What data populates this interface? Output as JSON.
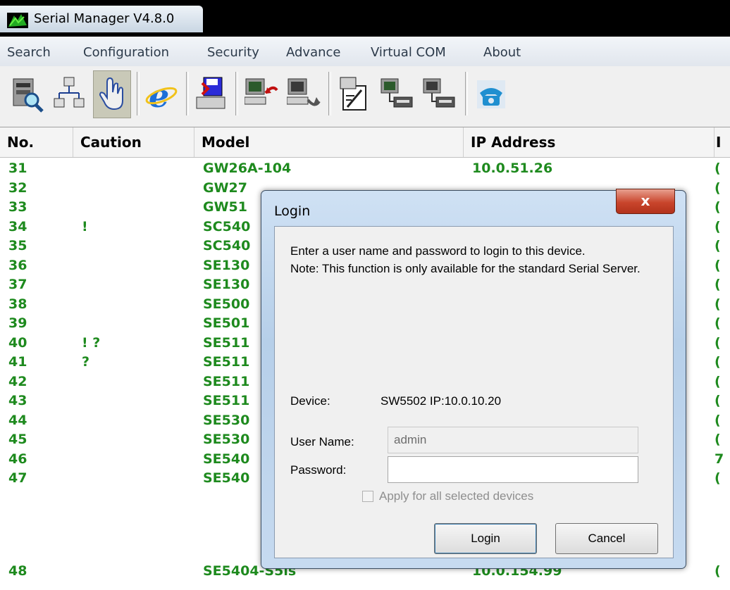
{
  "window": {
    "title": "Serial Manager V4.8.0"
  },
  "menu": [
    {
      "label": "Search"
    },
    {
      "label": "Configuration"
    },
    {
      "label": "Security"
    },
    {
      "label": "Advance"
    },
    {
      "label": "Virtual COM"
    },
    {
      "label": "About"
    }
  ],
  "toolbar": {
    "buttons": [
      {
        "icon": "search-device-icon"
      },
      {
        "icon": "network-icon"
      },
      {
        "icon": "hand-pointer-icon",
        "pressed": true
      },
      {
        "icon": "internet-explorer-icon"
      },
      {
        "icon": "save-to-device-icon"
      },
      {
        "icon": "computer-upload-icon"
      },
      {
        "icon": "computer-download-icon"
      },
      {
        "icon": "edit-config-icon"
      },
      {
        "icon": "serial-device-1-icon"
      },
      {
        "icon": "serial-device-2-icon"
      },
      {
        "icon": "telephone-icon"
      }
    ]
  },
  "table": {
    "columns": [
      "No.",
      "Caution",
      "Model",
      "IP Address",
      "I"
    ],
    "rows": [
      {
        "no": "31",
        "caution": "",
        "model": "GW26A-104",
        "ip": "10.0.51.26",
        "extra": "("
      },
      {
        "no": "32",
        "caution": "",
        "model": "GW27",
        "ip": "",
        "extra": "("
      },
      {
        "no": "33",
        "caution": "",
        "model": "GW51",
        "ip": "",
        "extra": "("
      },
      {
        "no": "34",
        "caution": "!",
        "model": "SC540",
        "ip": "",
        "extra": "("
      },
      {
        "no": "35",
        "caution": "",
        "model": "SC540",
        "ip": "",
        "extra": "("
      },
      {
        "no": "36",
        "caution": "",
        "model": "SE130",
        "ip": "",
        "extra": "("
      },
      {
        "no": "37",
        "caution": "",
        "model": "SE130",
        "ip": "",
        "extra": "("
      },
      {
        "no": "38",
        "caution": "",
        "model": "SE500",
        "ip": "",
        "extra": "("
      },
      {
        "no": "39",
        "caution": "",
        "model": "SE501",
        "ip": "",
        "extra": "("
      },
      {
        "no": "40",
        "caution": "! ?",
        "model": "SE511",
        "ip": "",
        "extra": "("
      },
      {
        "no": "41",
        "caution": "?",
        "model": "SE511",
        "ip": "",
        "extra": "("
      },
      {
        "no": "42",
        "caution": "",
        "model": "SE511",
        "ip": "",
        "extra": "("
      },
      {
        "no": "43",
        "caution": "",
        "model": "SE511",
        "ip": "",
        "extra": "("
      },
      {
        "no": "44",
        "caution": "",
        "model": "SE530",
        "ip": "",
        "extra": "("
      },
      {
        "no": "45",
        "caution": "",
        "model": "SE530",
        "ip": "",
        "extra": "("
      },
      {
        "no": "46",
        "caution": "",
        "model": "SE540",
        "ip": "",
        "extra": "7"
      },
      {
        "no": "47",
        "caution": "",
        "model": "SE540",
        "ip": "",
        "extra": "("
      },
      {
        "no": "48",
        "caution": "",
        "model": "SE5404-S5is",
        "ip": "10.0.154.99",
        "extra": "("
      }
    ]
  },
  "dialog": {
    "title": "Login",
    "close_label": "x",
    "description_line1": "Enter a user name and password to login to this device.",
    "description_line2": "Note: This function is only available for the standard Serial Server.",
    "device_label": "Device:",
    "device_value": "SW5502   IP:10.0.10.20",
    "username_label": "User Name:",
    "username_value": "admin",
    "password_label": "Password:",
    "password_value": "",
    "apply_all_label": "Apply for all selected devices",
    "apply_all_checked": false,
    "apply_all_enabled": false,
    "login_button": "Login",
    "cancel_button": "Cancel"
  },
  "colors": {
    "row_text": "#1e8a1e",
    "title_bar": "#000000",
    "dialog_frame": "#c6daf0",
    "close_button": "#c9452c"
  }
}
